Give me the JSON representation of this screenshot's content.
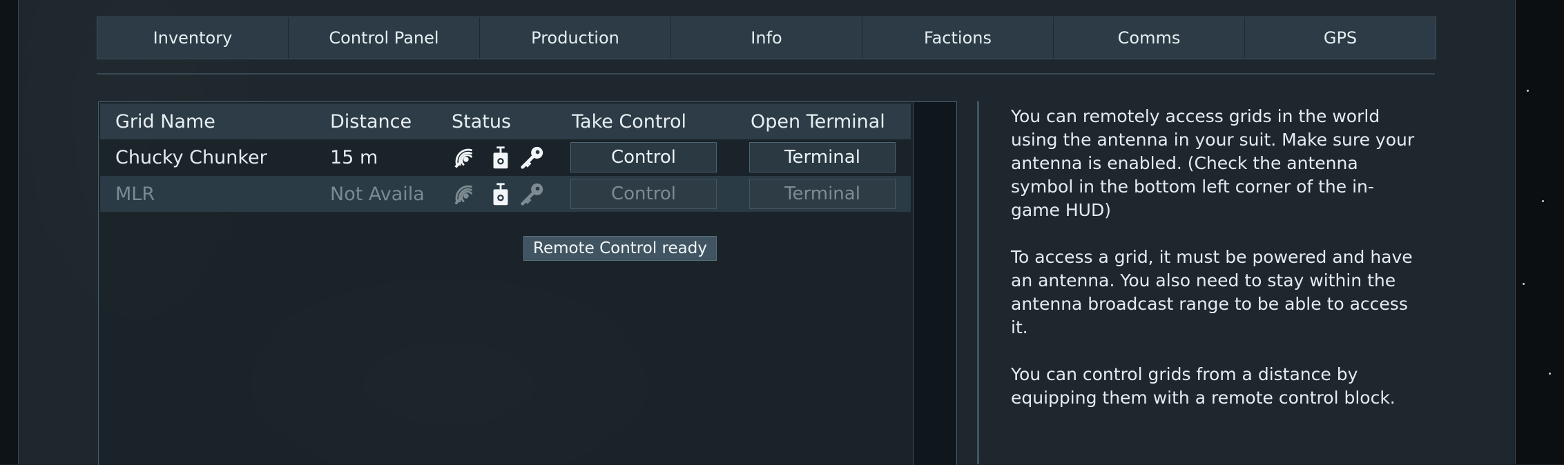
{
  "tabs": [
    {
      "label": "Inventory"
    },
    {
      "label": "Control Panel"
    },
    {
      "label": "Production"
    },
    {
      "label": "Info"
    },
    {
      "label": "Factions"
    },
    {
      "label": "Comms"
    },
    {
      "label": "GPS"
    }
  ],
  "grid_table": {
    "columns": {
      "name": "Grid Name",
      "distance": "Distance",
      "status": "Status",
      "take_control": "Take Control",
      "open_terminal": "Open Terminal"
    },
    "rows": [
      {
        "name": "Chucky Chunker",
        "distance": "15 m",
        "control_label": "Control",
        "terminal_label": "Terminal",
        "status_icons": [
          "antenna-icon",
          "remote-control-icon",
          "key-icon"
        ],
        "enabled": true
      },
      {
        "name": "MLR",
        "distance": "Not Availa",
        "control_label": "Control",
        "terminal_label": "Terminal",
        "status_icons": [
          "antenna-icon",
          "remote-control-icon",
          "key-icon"
        ],
        "enabled": false
      }
    ]
  },
  "tooltip": "Remote Control ready",
  "info": {
    "para1": "You can remotely access grids in the world using the antenna in your suit. Make sure your antenna is enabled. (Check the antenna symbol in the bottom left corner of the in-game HUD)",
    "para2": "To access a grid, it must be powered and have an antenna. You also need to stay within the antenna broadcast range to be able to access it.",
    "para3": "You can control grids from a distance by equipping them with a remote control block."
  },
  "colors": {
    "tab_bg": "#2c3b45",
    "text": "#e2ebf0",
    "disabled_text": "#7b8a92",
    "accent_border": "#47606e"
  }
}
